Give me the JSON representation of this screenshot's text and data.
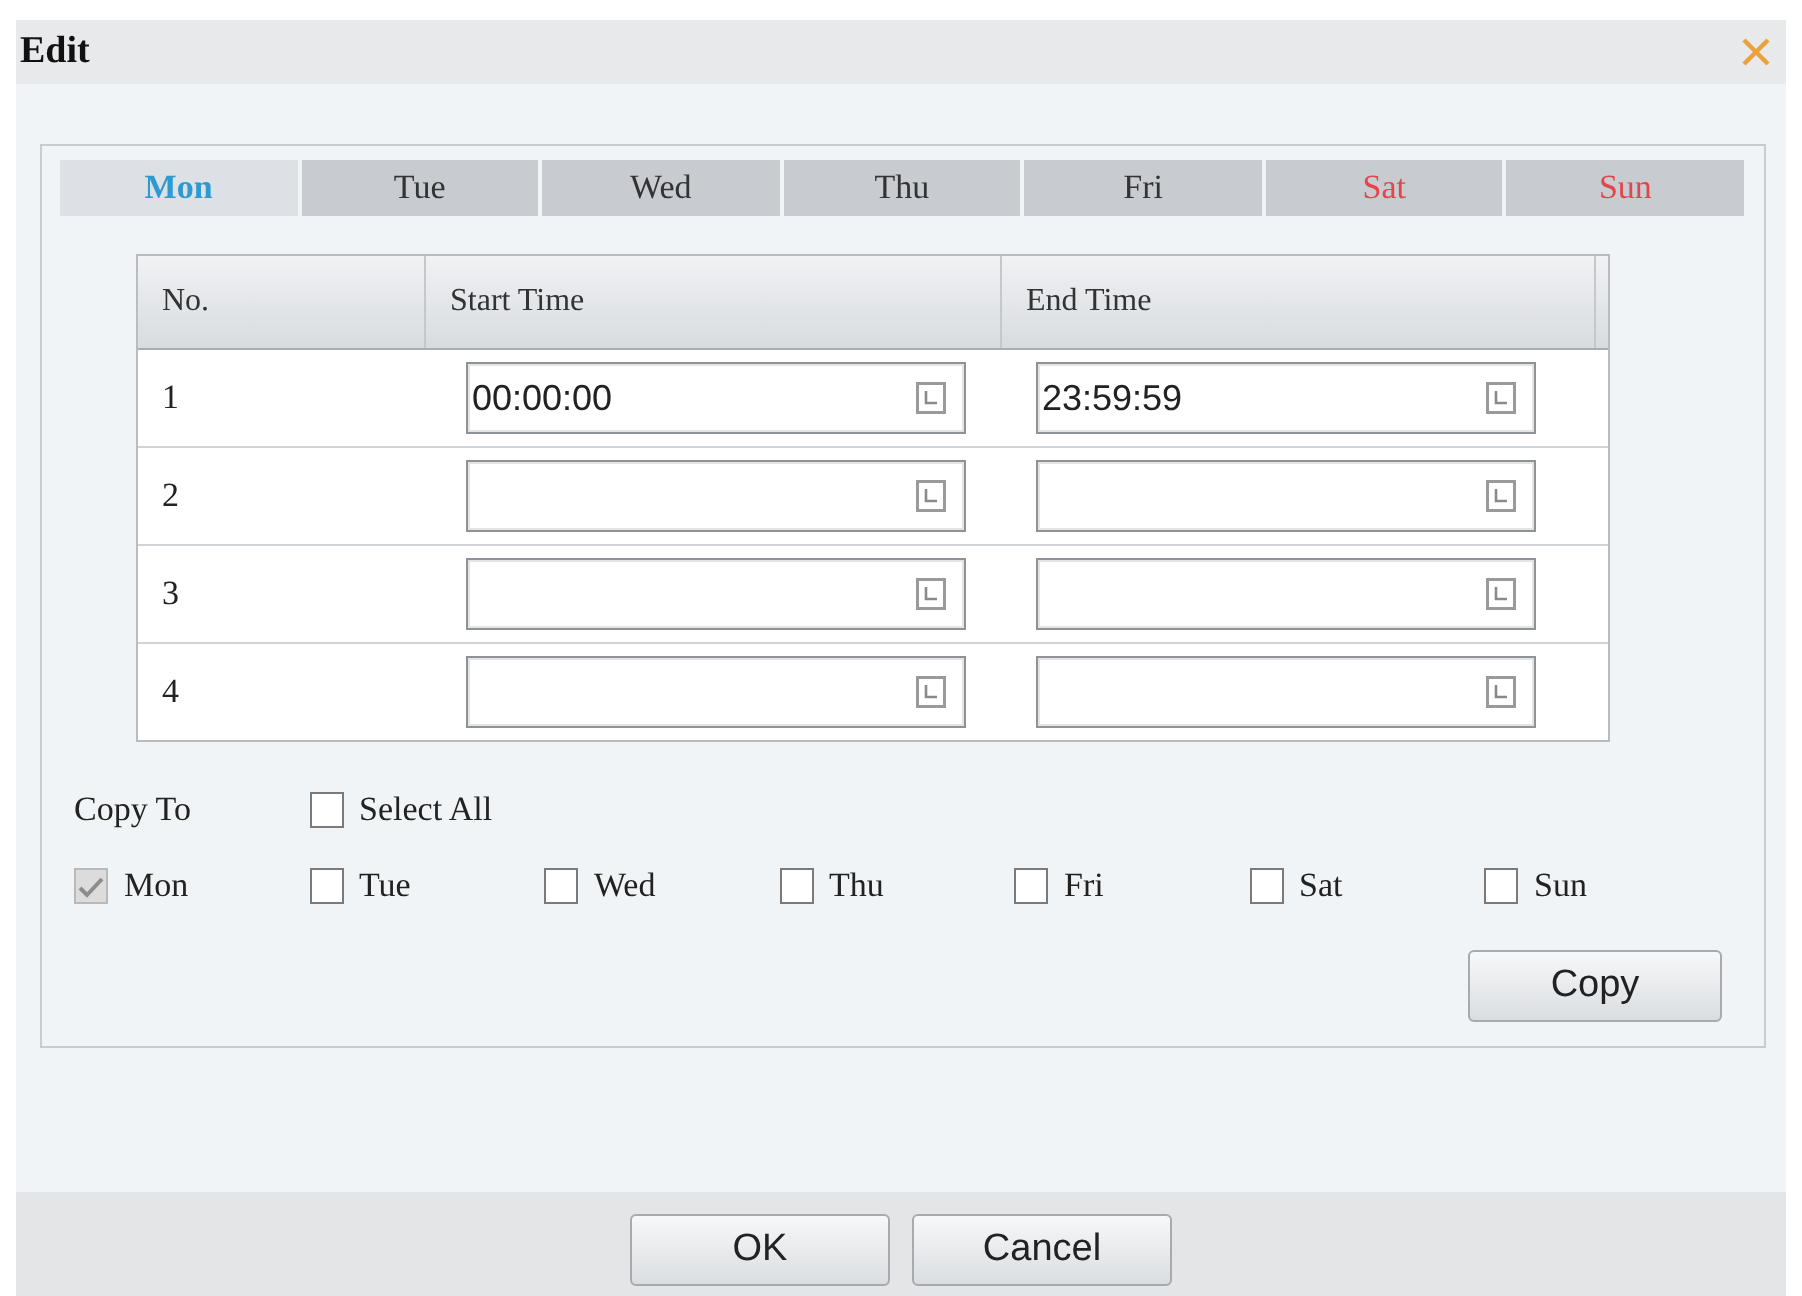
{
  "window": {
    "title": "Edit"
  },
  "tabs": [
    {
      "label": "Mon",
      "selected": true,
      "kind": "weekday"
    },
    {
      "label": "Tue",
      "selected": false,
      "kind": "weekday"
    },
    {
      "label": "Wed",
      "selected": false,
      "kind": "weekday"
    },
    {
      "label": "Thu",
      "selected": false,
      "kind": "weekday"
    },
    {
      "label": "Fri",
      "selected": false,
      "kind": "weekday"
    },
    {
      "label": "Sat",
      "selected": false,
      "kind": "weekend"
    },
    {
      "label": "Sun",
      "selected": false,
      "kind": "weekend"
    }
  ],
  "table": {
    "columns": [
      "No.",
      "Start Time",
      "End Time"
    ],
    "rows": [
      {
        "no": "1",
        "start_time": "00:00:00",
        "end_time": "23:59:59"
      },
      {
        "no": "2"
      },
      {
        "no": "3"
      },
      {
        "no": "4"
      }
    ]
  },
  "copy_to": {
    "label": "Copy To",
    "select_all": {
      "label": "Select All",
      "checked": false,
      "disabled": false
    },
    "days": [
      {
        "label": "Mon",
        "checked": true,
        "disabled": true
      },
      {
        "label": "Tue",
        "checked": false,
        "disabled": false
      },
      {
        "label": "Wed",
        "checked": false,
        "disabled": false
      },
      {
        "label": "Thu",
        "checked": false,
        "disabled": false
      },
      {
        "label": "Fri",
        "checked": false,
        "disabled": false
      },
      {
        "label": "Sat",
        "checked": false,
        "disabled": false
      },
      {
        "label": "Sun",
        "checked": false,
        "disabled": false
      }
    ],
    "button": "Copy"
  },
  "buttons": [
    "OK",
    "Cancel"
  ]
}
